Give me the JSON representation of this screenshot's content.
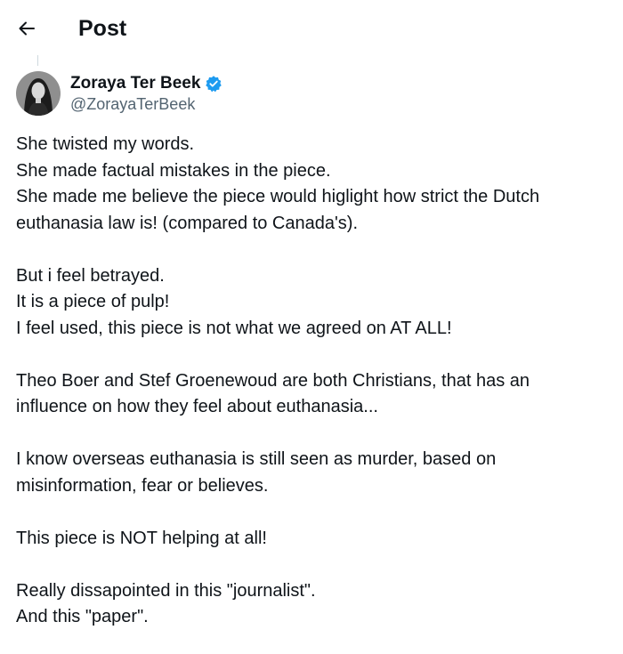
{
  "header": {
    "title": "Post",
    "back_icon": "arrow-left-icon"
  },
  "author": {
    "display_name": "Zoraya Ter Beek",
    "handle": "@ZorayaTerBeek",
    "verified_icon": "verified-badge-icon",
    "verified_color": "#1d9bf0"
  },
  "tweet": {
    "paragraphs": [
      [
        "She twisted my words.",
        "She made factual mistakes in the piece.",
        "She made me believe the piece would higlight how strict the Dutch",
        "euthanasia law is! (compared to Canada's)."
      ],
      [
        "But i feel betrayed.",
        "It is a piece of pulp!",
        "I feel used, this piece is not what we agreed on AT ALL!"
      ],
      [
        "Theo Boer and Stef Groenewoud are both Christians, that has an",
        "influence on how they feel about euthanasia..."
      ],
      [
        "I know overseas euthanasia is still seen as murder, based on",
        "misinformation, fear or believes."
      ],
      [
        "This piece is NOT helping at all!"
      ],
      [
        "Really dissapointed in this \"journalist\".",
        "And this \"paper\"."
      ]
    ]
  }
}
